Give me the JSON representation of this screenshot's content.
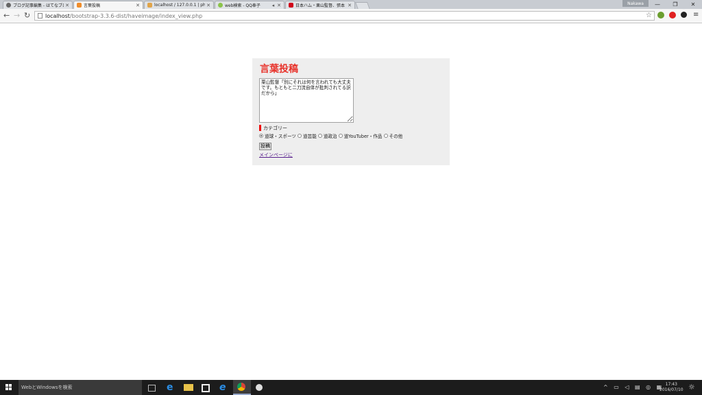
{
  "browser": {
    "tabs": [
      {
        "title": "ブログ記事編集 - はてなブロ",
        "icon_color": "#666666"
      },
      {
        "title": "言葉投稿",
        "icon_color": "#f08c2a"
      },
      {
        "title": "localhost / 127.0.0.1 | php",
        "icon_color": "#e0a44a"
      },
      {
        "title": "web検索 - QQ奉子",
        "icon_color": "#8bc34a"
      },
      {
        "title": "日本ハム・栗山監督、張本",
        "icon_color": "#d0021b"
      }
    ],
    "profile_name": "Nakawa",
    "address_host": "localhost",
    "address_path": "/bootstrap-3.3.6-dist/haveimage/index_view.php",
    "window_buttons": [
      "—",
      "❐",
      "✕"
    ]
  },
  "page": {
    "title": "言葉投稿",
    "message": "栗山監督「別にそれは何を言われても大丈夫です。もともと二刀流自体が批判されてる訳だから」",
    "category_label": "カテゴリー",
    "categories": [
      {
        "label": "道球・スポーツ",
        "checked": true
      },
      {
        "label": "道芸能",
        "checked": false
      },
      {
        "label": "道政治",
        "checked": false
      },
      {
        "label": "道YouTuber・作品",
        "checked": false
      },
      {
        "label": "その他",
        "checked": false
      }
    ],
    "submit_label": "投稿",
    "main_link": "メインページに"
  },
  "taskbar": {
    "search_placeholder": "WebとWindowsを検索",
    "time": "17:43",
    "date": "2016/07/10"
  },
  "colors": {
    "title": "#e8322a",
    "panel_bg": "#eeeeee",
    "category_bar": "#ee0000",
    "link": "#551a8b"
  }
}
